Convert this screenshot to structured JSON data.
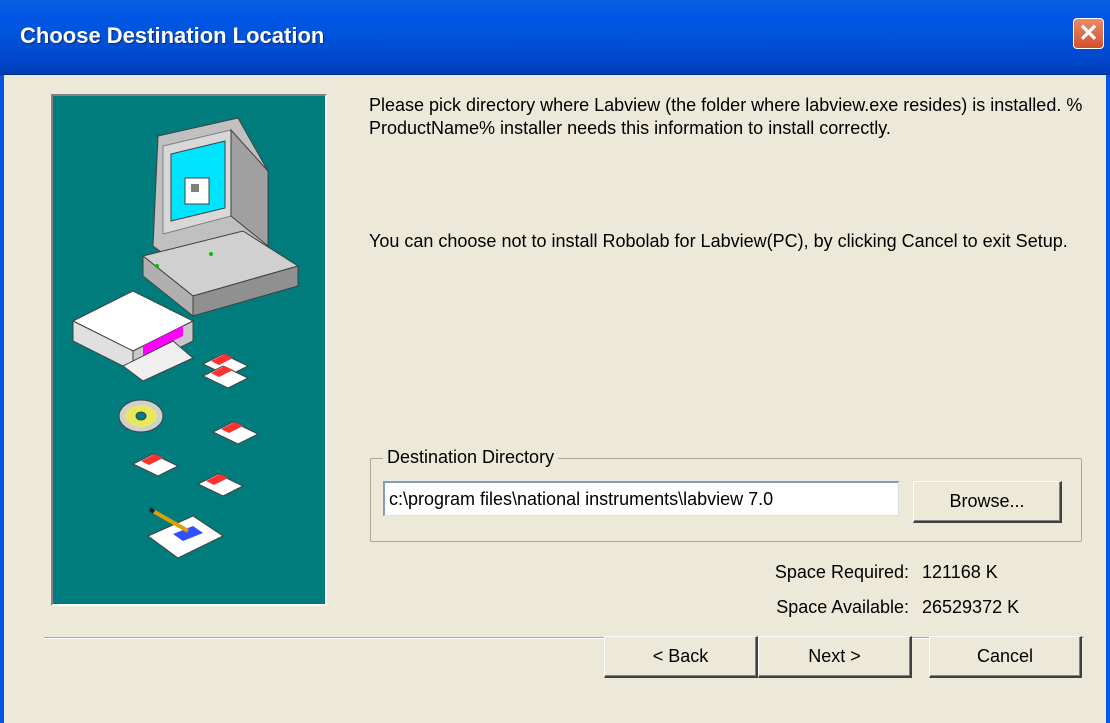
{
  "window": {
    "title": "Choose Destination Location",
    "close_glyph": "✕"
  },
  "body": {
    "paragraph1": "Please pick directory where Labview (the folder where labview.exe resides) is installed. % ProductName% installer needs this information to install correctly.",
    "paragraph2": "You can choose not to install Robolab for Labview(PC), by clicking Cancel to exit Setup."
  },
  "destination": {
    "legend": "Destination Directory",
    "path_value": "c:\\program files\\national instruments\\labview 7.0",
    "browse_label": "Browse..."
  },
  "space": {
    "required_label": "Space Required:",
    "required_value": "121168 K",
    "available_label": "Space Available:",
    "available_value": "26529372 K"
  },
  "buttons": {
    "back_label": "< Back",
    "next_label": "Next >",
    "cancel_label": "Cancel"
  },
  "colors": {
    "title_bar": "#0055e5",
    "dialog_bg": "#ece9d8",
    "art_bg": "#007c7c",
    "close_button": "#d4502b"
  },
  "icons": {
    "close": "close-icon",
    "artwork": "setup-illustration"
  }
}
